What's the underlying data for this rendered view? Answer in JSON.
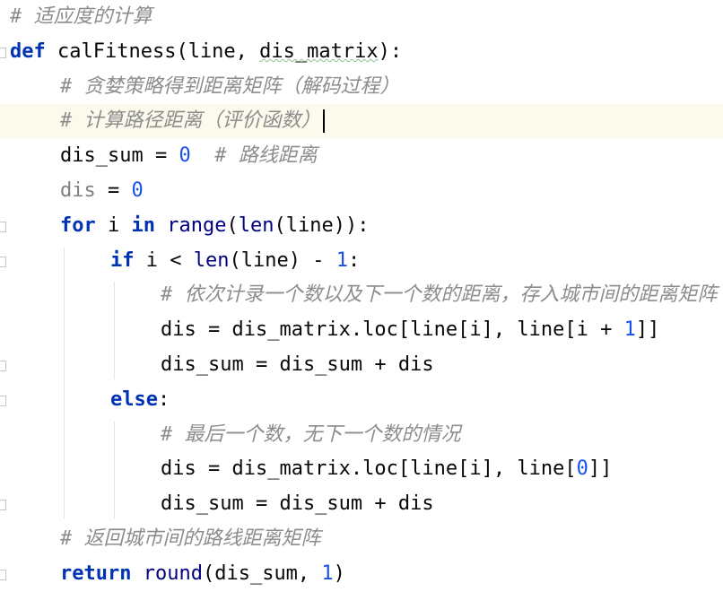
{
  "editor": {
    "language": "python",
    "lines": [
      {
        "indent": 0,
        "tokens": [
          {
            "t": "cmt",
            "v": "# 适应度的计算"
          }
        ]
      },
      {
        "indent": 0,
        "tokens": [
          {
            "t": "kw",
            "v": "def"
          },
          {
            "t": "plain",
            "v": " calFitness(line, "
          },
          {
            "t": "typo",
            "v": "dis_matrix"
          },
          {
            "t": "plain",
            "v": "):"
          }
        ]
      },
      {
        "indent": 1,
        "tokens": [
          {
            "t": "cmt",
            "v": "# 贪婪策略得到距离矩阵（解码过程）"
          }
        ]
      },
      {
        "indent": 1,
        "current": true,
        "caret": true,
        "tokens": [
          {
            "t": "cmt",
            "v": "# 计算路径距离（评价函数）"
          }
        ]
      },
      {
        "indent": 1,
        "tokens": [
          {
            "t": "plain",
            "v": "dis_sum = "
          },
          {
            "t": "num",
            "v": "0"
          },
          {
            "t": "plain",
            "v": "  "
          },
          {
            "t": "cmt",
            "v": "# 路线距离"
          }
        ]
      },
      {
        "indent": 1,
        "tokens": [
          {
            "t": "unused",
            "v": "dis"
          },
          {
            "t": "plain",
            "v": " = "
          },
          {
            "t": "num",
            "v": "0"
          }
        ]
      },
      {
        "indent": 1,
        "tokens": [
          {
            "t": "kw",
            "v": "for"
          },
          {
            "t": "plain",
            "v": " i "
          },
          {
            "t": "kw",
            "v": "in"
          },
          {
            "t": "plain",
            "v": " "
          },
          {
            "t": "builtin",
            "v": "range"
          },
          {
            "t": "plain",
            "v": "("
          },
          {
            "t": "builtin",
            "v": "len"
          },
          {
            "t": "plain",
            "v": "(line)):"
          }
        ]
      },
      {
        "indent": 2,
        "tokens": [
          {
            "t": "kw",
            "v": "if"
          },
          {
            "t": "plain",
            "v": " i < "
          },
          {
            "t": "builtin",
            "v": "len"
          },
          {
            "t": "plain",
            "v": "(line) - "
          },
          {
            "t": "num",
            "v": "1"
          },
          {
            "t": "plain",
            "v": ":"
          }
        ]
      },
      {
        "indent": 3,
        "tokens": [
          {
            "t": "cmt",
            "v": "# 依次计录一个数以及下一个数的距离，存入城市间的距离矩阵"
          }
        ]
      },
      {
        "indent": 3,
        "tokens": [
          {
            "t": "plain",
            "v": "dis = dis_matrix.loc[line[i], line[i + "
          },
          {
            "t": "num",
            "v": "1"
          },
          {
            "t": "plain",
            "v": "]]"
          }
        ]
      },
      {
        "indent": 3,
        "tokens": [
          {
            "t": "plain",
            "v": "dis_sum = dis_sum + dis"
          }
        ]
      },
      {
        "indent": 2,
        "tokens": [
          {
            "t": "kw",
            "v": "else"
          },
          {
            "t": "plain",
            "v": ":"
          }
        ]
      },
      {
        "indent": 3,
        "tokens": [
          {
            "t": "cmt",
            "v": "# 最后一个数，无下一个数的情况"
          }
        ]
      },
      {
        "indent": 3,
        "tokens": [
          {
            "t": "plain",
            "v": "dis = dis_matrix.loc[line[i], line["
          },
          {
            "t": "num",
            "v": "0"
          },
          {
            "t": "plain",
            "v": "]]"
          }
        ]
      },
      {
        "indent": 3,
        "tokens": [
          {
            "t": "plain",
            "v": "dis_sum = dis_sum + dis"
          }
        ]
      },
      {
        "indent": 1,
        "tokens": [
          {
            "t": "cmt",
            "v": "# 返回城市间的路线距离矩阵"
          }
        ]
      },
      {
        "indent": 1,
        "tokens": [
          {
            "t": "kw",
            "v": "return"
          },
          {
            "t": "plain",
            "v": " "
          },
          {
            "t": "builtin",
            "v": "round"
          },
          {
            "t": "plain",
            "v": "(dis_sum, "
          },
          {
            "t": "num",
            "v": "1"
          },
          {
            "t": "plain",
            "v": ")"
          }
        ]
      }
    ]
  },
  "colors": {
    "keyword": "#0033b3",
    "number": "#1750eb",
    "builtin": "#000080",
    "comment": "#8c8c8c",
    "unused": "#808080",
    "current_line": "#fcfaed"
  }
}
